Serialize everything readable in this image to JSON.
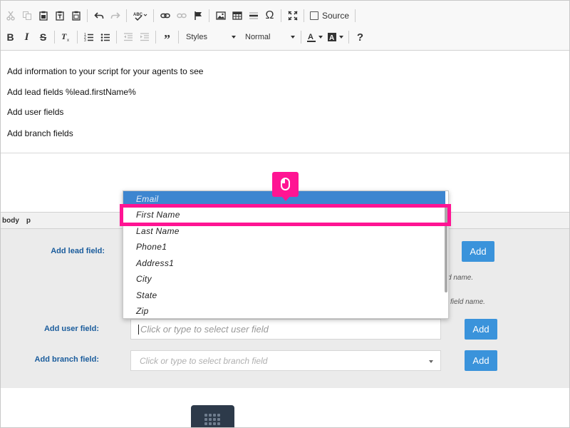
{
  "toolbar": {
    "source_label": "Source",
    "styles_label": "Styles",
    "format_label": "Normal"
  },
  "editor": {
    "lines": [
      "Add information to your script for your agents to see",
      "Add lead fields %lead.firstName%",
      "Add user fields",
      "Add branch fields"
    ]
  },
  "statusbar": {
    "path": [
      "body",
      "p"
    ]
  },
  "form": {
    "lead_label": "Add lead field:",
    "user_label": "Add user field:",
    "branch_label": "Add branch field:",
    "user_placeholder": "Click or type to select user field",
    "branch_placeholder": "Click or type to select branch field",
    "add_label": "Add",
    "hint1": "d name.",
    "hint2": "field name."
  },
  "dropdown": {
    "items": [
      "Email",
      "First Name",
      "Last Name",
      "Phone1",
      "Address1",
      "City",
      "State",
      "Zip"
    ],
    "selected": "Email",
    "hover": "First Name"
  },
  "colors": {
    "accent": "#3a93db",
    "highlight": "#ff1493",
    "label": "#1a5c9c"
  }
}
